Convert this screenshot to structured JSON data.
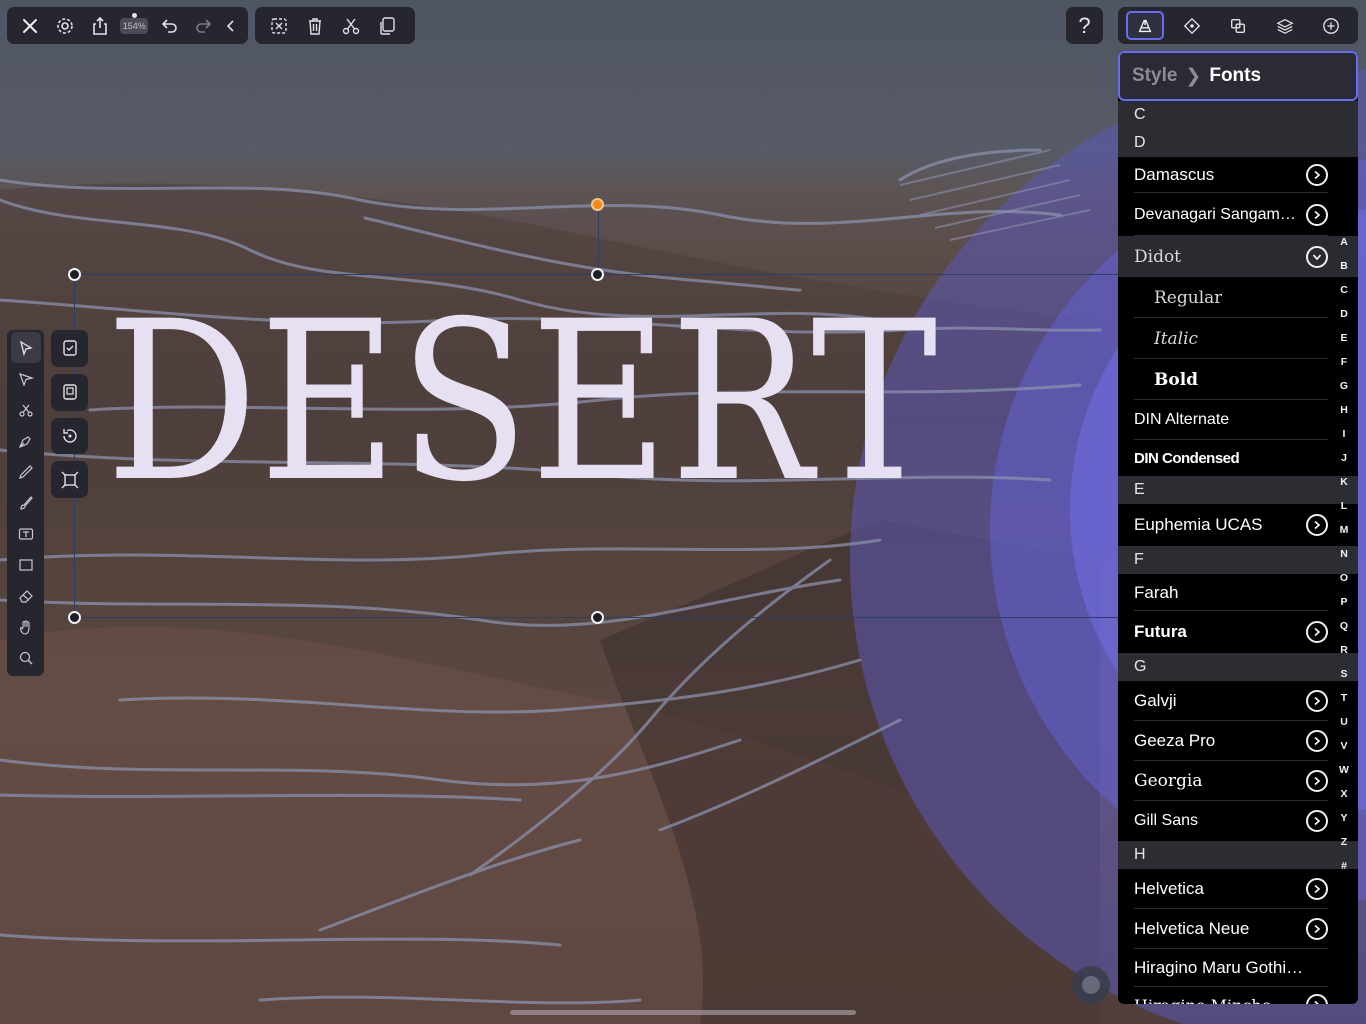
{
  "top_toolbar": {
    "zoom_label": "154%",
    "buttons": [
      "close-icon",
      "gear-icon",
      "share-icon",
      "zoom-badge",
      "undo-icon",
      "redo-icon",
      "collapse-chevron-icon"
    ]
  },
  "edit_toolbar": {
    "buttons": [
      "deselect-icon",
      "trash-icon",
      "scissors-icon",
      "duplicate-icon"
    ]
  },
  "help": {
    "label": "?"
  },
  "right_toolbar": {
    "buttons": [
      "style-brush-icon",
      "navigator-icon",
      "boolean-icon",
      "layers-icon",
      "add-icon"
    ],
    "active": "style-brush-icon"
  },
  "tools": [
    "select-arrow-icon",
    "direct-select-icon",
    "scissors-icon",
    "pen-icon",
    "pencil-icon",
    "brush-icon",
    "text-tool-icon",
    "rectangle-icon",
    "eraser-icon",
    "hand-icon",
    "zoom-icon"
  ],
  "context_tools": [
    "checklist-icon",
    "paste-style-icon",
    "rotate-icon",
    "transform-icon"
  ],
  "canvas": {
    "text": "DESERT",
    "text_color": "#e6e0f2",
    "accent_circle_color": "#6a64d8"
  },
  "panel": {
    "breadcrumb_parent": "Style",
    "breadcrumb_current": "Fonts",
    "rows": [
      {
        "type": "section",
        "label": "C"
      },
      {
        "type": "section",
        "label": "D"
      },
      {
        "type": "font",
        "label": "Damascus",
        "chevron": true
      },
      {
        "type": "font",
        "label": "Devanagari Sangam…",
        "chevron": true
      },
      {
        "type": "font",
        "label": "Didot",
        "chevron": true,
        "expanded": true
      },
      {
        "type": "sub",
        "label": "Regular"
      },
      {
        "type": "sub",
        "label": "Italic"
      },
      {
        "type": "sub",
        "label": "Bold"
      },
      {
        "type": "font",
        "label": "DIN Alternate"
      },
      {
        "type": "font",
        "label": "DIN Condensed"
      },
      {
        "type": "section",
        "label": "E"
      },
      {
        "type": "font",
        "label": "Euphemia UCAS",
        "chevron": true
      },
      {
        "type": "section",
        "label": "F"
      },
      {
        "type": "font",
        "label": "Farah"
      },
      {
        "type": "font",
        "label": "Futura",
        "chevron": true
      },
      {
        "type": "section",
        "label": "G"
      },
      {
        "type": "font",
        "label": "Galvji",
        "chevron": true
      },
      {
        "type": "font",
        "label": "Geeza Pro",
        "chevron": true
      },
      {
        "type": "font",
        "label": "Georgia",
        "chevron": true
      },
      {
        "type": "font",
        "label": "Gill Sans",
        "chevron": true
      },
      {
        "type": "section",
        "label": "H"
      },
      {
        "type": "font",
        "label": "Helvetica",
        "chevron": true
      },
      {
        "type": "font",
        "label": "Helvetica Neue",
        "chevron": true
      },
      {
        "type": "font",
        "label": "Hiragino Maru Gothi…"
      },
      {
        "type": "font",
        "label": "Hiragino Mincho…",
        "chevron": true
      }
    ],
    "alphabet_index": [
      "A",
      "B",
      "C",
      "D",
      "E",
      "F",
      "G",
      "H",
      "I",
      "J",
      "K",
      "L",
      "M",
      "N",
      "O",
      "P",
      "Q",
      "R",
      "S",
      "T",
      "U",
      "V",
      "W",
      "X",
      "Y",
      "Z",
      "#"
    ]
  }
}
